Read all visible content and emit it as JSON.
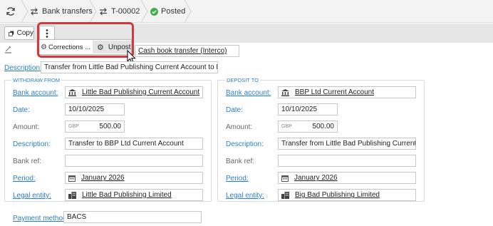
{
  "breadcrumb": {
    "item1": "Bank transfers",
    "item2": "T-00002",
    "status": "Posted"
  },
  "toolbar": {
    "copy_label": "Copy"
  },
  "menu": {
    "corrections_label": "Corrections ...",
    "unpost_label": "Unpost"
  },
  "header": {
    "type_value": "Cash book transfer (Interco)",
    "description_label": "Description:",
    "description_value": "Transfer from Little Bad Publishing Current Account to BBP Ltd Curre..."
  },
  "withdraw": {
    "title": "WITHDRAW FROM",
    "bank_account_label": "Bank account:",
    "bank_account": "Little Bad Publishing Current Account",
    "date_label": "Date:",
    "date": "10/10/2025",
    "amount_label": "Amount:",
    "currency": "GBP",
    "amount": "500.00",
    "description_label": "Description:",
    "description": "Transfer to BBP Ltd Current Account",
    "bank_ref_label": "Bank ref:",
    "bank_ref": "",
    "period_label": "Period:",
    "period": "January 2026",
    "legal_entity_label": "Legal entity:",
    "legal_entity": "Little Bad Publishing Limited"
  },
  "deposit": {
    "title": "DEPOSIT TO",
    "bank_account_label": "Bank account:",
    "bank_account": "BBP Ltd Current Account",
    "date_label": "Date:",
    "date": "10/10/2025",
    "amount_label": "Amount:",
    "currency": "GBP",
    "amount": "500.00",
    "description_label": "Description:",
    "description": "Transfer from Little Bad Publishing Current Acc...",
    "bank_ref_label": "Bank ref:",
    "bank_ref": "",
    "period_label": "Period:",
    "period": "January 2026",
    "legal_entity_label": "Legal entity:",
    "legal_entity": "Big Bad Publishing Limited"
  },
  "footer": {
    "payment_method_label": "Payment method:",
    "payment_method": "BACS"
  },
  "colors": {
    "accent": "#2a7fc9",
    "highlight": "#d3393c",
    "status_ok": "#3fae49"
  },
  "icons": [
    "refresh-icon",
    "transfer-icon",
    "check-circle-icon",
    "copy-icon",
    "more-vertical-icon",
    "gear-icon",
    "cursor-icon",
    "bank-icon",
    "calendar-icon",
    "building-icon",
    "edit-icon"
  ]
}
